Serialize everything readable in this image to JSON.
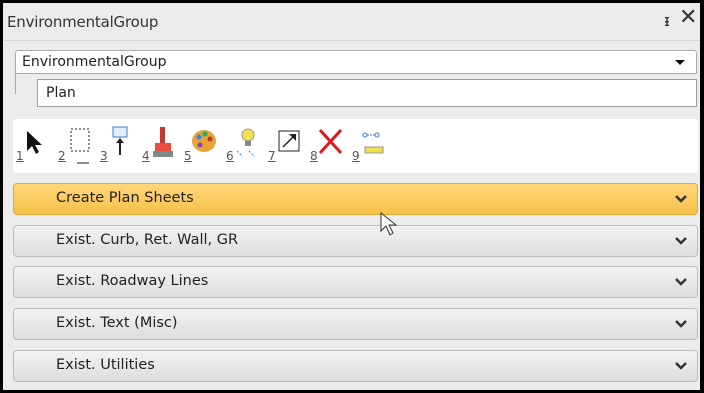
{
  "window": {
    "title": "EnvironmentalGroup"
  },
  "group_combo": {
    "value": "EnvironmentalGroup"
  },
  "plan_field": {
    "value": "Plan"
  },
  "toolbar": {
    "tools": [
      {
        "num": "1",
        "icon": "pointer-icon"
      },
      {
        "num": "2",
        "icon": "select-box-icon"
      },
      {
        "num": "3",
        "icon": "place-element-icon"
      },
      {
        "num": "4",
        "icon": "brush-icon"
      },
      {
        "num": "5",
        "icon": "palette-icon"
      },
      {
        "num": "6",
        "icon": "highlight-bulb-icon"
      },
      {
        "num": "7",
        "icon": "scale-icon"
      },
      {
        "num": "8",
        "icon": "delete-x-icon"
      },
      {
        "num": "9",
        "icon": "measure-icon"
      }
    ]
  },
  "sections": [
    {
      "label": "Create Plan Sheets",
      "active": true
    },
    {
      "label": "Exist. Curb, Ret. Wall, GR",
      "active": false
    },
    {
      "label": "Exist. Roadway Lines",
      "active": false
    },
    {
      "label": "Exist. Text (Misc)",
      "active": false
    },
    {
      "label": "Exist. Utilities",
      "active": false
    }
  ],
  "colors": {
    "active_section": "#f7c14a",
    "delete": "#e01818"
  }
}
